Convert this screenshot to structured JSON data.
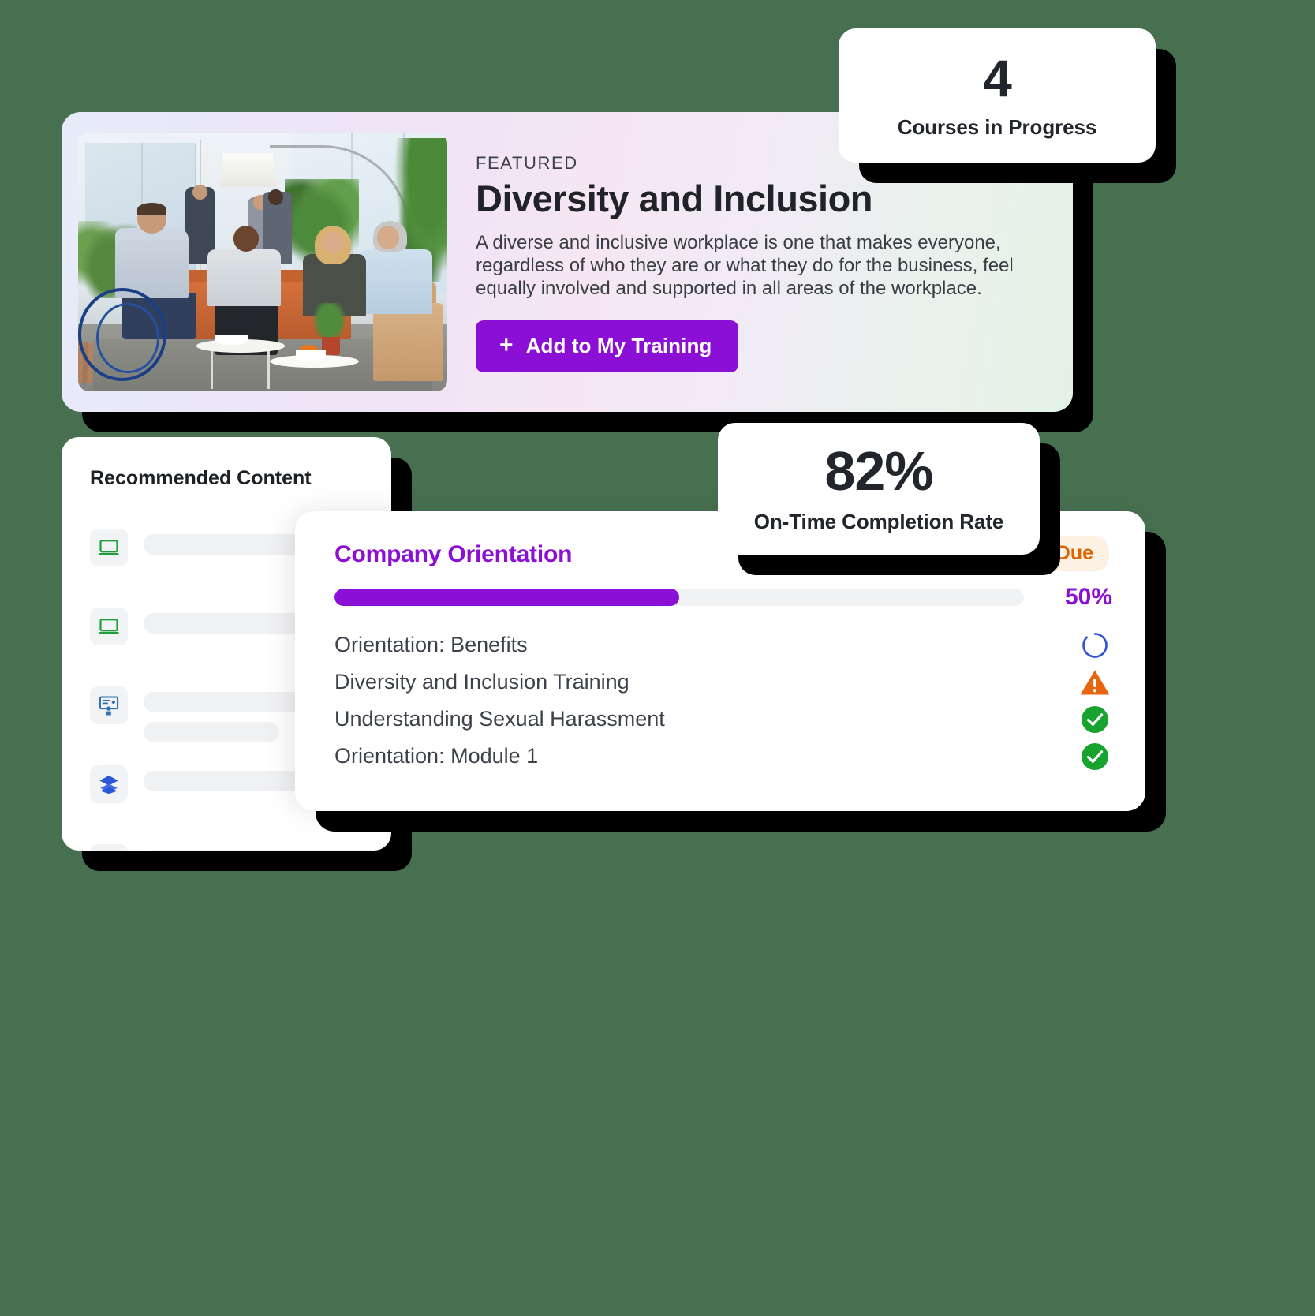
{
  "background_color": "#477050",
  "accent_purple": "#8B0FD4",
  "featured": {
    "eyebrow": "FEATURED",
    "title": "Diversity and Inclusion",
    "description": "A diverse and inclusive workplace is one that makes everyone, regardless of who they are or what they do for the business, feel equally involved and supported in all areas of the workplace.",
    "button_label": "Add to My Training",
    "button_plus": "+",
    "image_alt": "office-lounge-team-photo"
  },
  "stats": [
    {
      "value": "4",
      "label": "Courses in Progress"
    },
    {
      "value": "82%",
      "label": "On-Time Completion Rate"
    }
  ],
  "recommended": {
    "title": "Recommended Content",
    "items": [
      {
        "icon": "laptop-icon",
        "icon_color": "#1f9e3a",
        "lines": [
          "long"
        ]
      },
      {
        "icon": "laptop-icon",
        "icon_color": "#1f9e3a",
        "lines": [
          "long"
        ]
      },
      {
        "icon": "presentation-icon",
        "icon_color": "#2f6fb5",
        "lines": [
          "long",
          "short"
        ]
      },
      {
        "icon": "layers-icon",
        "icon_color": "#2a57d6",
        "lines": [
          "long"
        ]
      },
      {
        "icon": "laptop-icon",
        "icon_color": "#1f9e3a",
        "lines": [
          "long"
        ]
      }
    ]
  },
  "orientation": {
    "title": "Company Orientation",
    "badge": {
      "label": "Due",
      "color": "#de6305",
      "background": "#fdf1e3"
    },
    "progress": {
      "percent": 50,
      "percent_label": "50%",
      "fill_color": "#8B0FD4"
    },
    "modules": [
      {
        "name": "Orientation: Benefits",
        "status": "in-progress-spinner-icon",
        "status_color": "#2f52d6"
      },
      {
        "name": "Diversity and Inclusion Training",
        "status": "warning-triangle-icon",
        "status_color": "#e8650d"
      },
      {
        "name": "Understanding Sexual Harassment",
        "status": "check-circle-icon",
        "status_color": "#17a32e"
      },
      {
        "name": "Orientation: Module 1",
        "status": "check-circle-icon",
        "status_color": "#17a32e"
      }
    ]
  }
}
